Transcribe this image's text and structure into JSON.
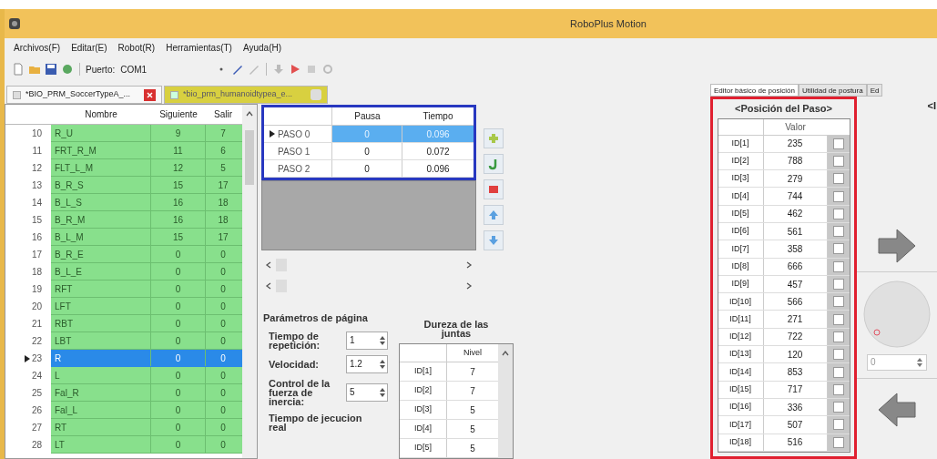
{
  "window": {
    "title": "RoboPlus Motion"
  },
  "menu": [
    "Archivos(F)",
    "Editar(E)",
    "Robot(R)",
    "Herramientas(T)",
    "Ayuda(H)"
  ],
  "toolbar": {
    "port_label": "Puerto:",
    "port_value": "COM1"
  },
  "document_tabs": [
    {
      "label": "*BIO_PRM_SoccerTypeA_...",
      "selected": false
    },
    {
      "label": "*bio_prm_humanoidtypea_e...",
      "selected": true
    }
  ],
  "pages_table": {
    "columns": [
      "Nombre",
      "Siguiente",
      "Salir"
    ],
    "rows": [
      {
        "number": "10",
        "name": "R_U",
        "next": "9",
        "exit": "7",
        "selected": false
      },
      {
        "number": "11",
        "name": "FRT_R_M",
        "next": "11",
        "exit": "6",
        "selected": false
      },
      {
        "number": "12",
        "name": "FLT_L_M",
        "next": "12",
        "exit": "5",
        "selected": false
      },
      {
        "number": "13",
        "name": "B_R_S",
        "next": "15",
        "exit": "17",
        "selected": false
      },
      {
        "number": "14",
        "name": "B_L_S",
        "next": "16",
        "exit": "18",
        "selected": false
      },
      {
        "number": "15",
        "name": "B_R_M",
        "next": "16",
        "exit": "18",
        "selected": false
      },
      {
        "number": "16",
        "name": "B_L_M",
        "next": "15",
        "exit": "17",
        "selected": false
      },
      {
        "number": "17",
        "name": "B_R_E",
        "next": "0",
        "exit": "0",
        "selected": false
      },
      {
        "number": "18",
        "name": "B_L_E",
        "next": "0",
        "exit": "0",
        "selected": false
      },
      {
        "number": "19",
        "name": "RFT",
        "next": "0",
        "exit": "0",
        "selected": false
      },
      {
        "number": "20",
        "name": "LFT",
        "next": "0",
        "exit": "0",
        "selected": false
      },
      {
        "number": "21",
        "name": "RBT",
        "next": "0",
        "exit": "0",
        "selected": false
      },
      {
        "number": "22",
        "name": "LBT",
        "next": "0",
        "exit": "0",
        "selected": false
      },
      {
        "number": "23",
        "name": "R",
        "next": "0",
        "exit": "0",
        "selected": true
      },
      {
        "number": "24",
        "name": "L",
        "next": "0",
        "exit": "0",
        "selected": false
      },
      {
        "number": "25",
        "name": "Fal_R",
        "next": "0",
        "exit": "0",
        "selected": false
      },
      {
        "number": "26",
        "name": "Fal_L",
        "next": "0",
        "exit": "0",
        "selected": false
      },
      {
        "number": "27",
        "name": "RT",
        "next": "0",
        "exit": "0",
        "selected": false
      },
      {
        "number": "28",
        "name": "LT",
        "next": "0",
        "exit": "0",
        "selected": false
      }
    ]
  },
  "steps_table": {
    "columns": [
      "Pausa",
      "Tiempo"
    ],
    "rows": [
      {
        "label": "PASO 0",
        "pause": "0",
        "time": "0.096",
        "selected": true
      },
      {
        "label": "PASO 1",
        "pause": "0",
        "time": "0.072",
        "selected": false
      },
      {
        "label": "PASO 2",
        "pause": "0",
        "time": "0.096",
        "selected": false
      }
    ]
  },
  "page_parameters": {
    "title": "Parámetros de página",
    "fields": [
      {
        "label": "Tiempo de repetición:",
        "value": "1"
      },
      {
        "label": "Velocidad:",
        "value": "1.2"
      },
      {
        "label": "Control de la fuerza de inercia:",
        "value": "5"
      }
    ],
    "execution_label": "Tiempo de jecucion real"
  },
  "joint_hardness": {
    "title": "Dureza de las juntas",
    "column": "Nivel",
    "rows": [
      {
        "id": "ID[1]",
        "value": "7"
      },
      {
        "id": "ID[2]",
        "value": "7"
      },
      {
        "id": "ID[3]",
        "value": "5"
      },
      {
        "id": "ID[4]",
        "value": "5"
      },
      {
        "id": "ID[5]",
        "value": "5"
      }
    ]
  },
  "right_tabs": [
    {
      "label": "Editor básico de posición",
      "selected": true
    },
    {
      "label": "Utilidad de postura",
      "selected": false
    },
    {
      "label": "Ed",
      "selected": false
    }
  ],
  "step_position": {
    "title": "<Posición del Paso>",
    "column": "Valor",
    "rows": [
      {
        "id": "ID[1]",
        "value": "235",
        "checked": false
      },
      {
        "id": "ID[2]",
        "value": "788",
        "checked": false
      },
      {
        "id": "ID[3]",
        "value": "279",
        "checked": false
      },
      {
        "id": "ID[4]",
        "value": "744",
        "checked": false
      },
      {
        "id": "ID[5]",
        "value": "462",
        "checked": false
      },
      {
        "id": "ID[6]",
        "value": "561",
        "checked": false
      },
      {
        "id": "ID[7]",
        "value": "358",
        "checked": false
      },
      {
        "id": "ID[8]",
        "value": "666",
        "checked": false
      },
      {
        "id": "ID[9]",
        "value": "457",
        "checked": false
      },
      {
        "id": "ID[10]",
        "value": "566",
        "checked": false
      },
      {
        "id": "ID[11]",
        "value": "271",
        "checked": false
      },
      {
        "id": "ID[12]",
        "value": "722",
        "checked": false
      },
      {
        "id": "ID[13]",
        "value": "120",
        "checked": false
      },
      {
        "id": "ID[14]",
        "value": "853",
        "checked": false
      },
      {
        "id": "ID[15]",
        "value": "717",
        "checked": false
      },
      {
        "id": "ID[16]",
        "value": "336",
        "checked": false
      },
      {
        "id": "ID[17]",
        "value": "507",
        "checked": false
      },
      {
        "id": "ID[18]",
        "value": "516",
        "checked": false
      }
    ]
  },
  "side_heading": "<I",
  "knob_value": "0"
}
